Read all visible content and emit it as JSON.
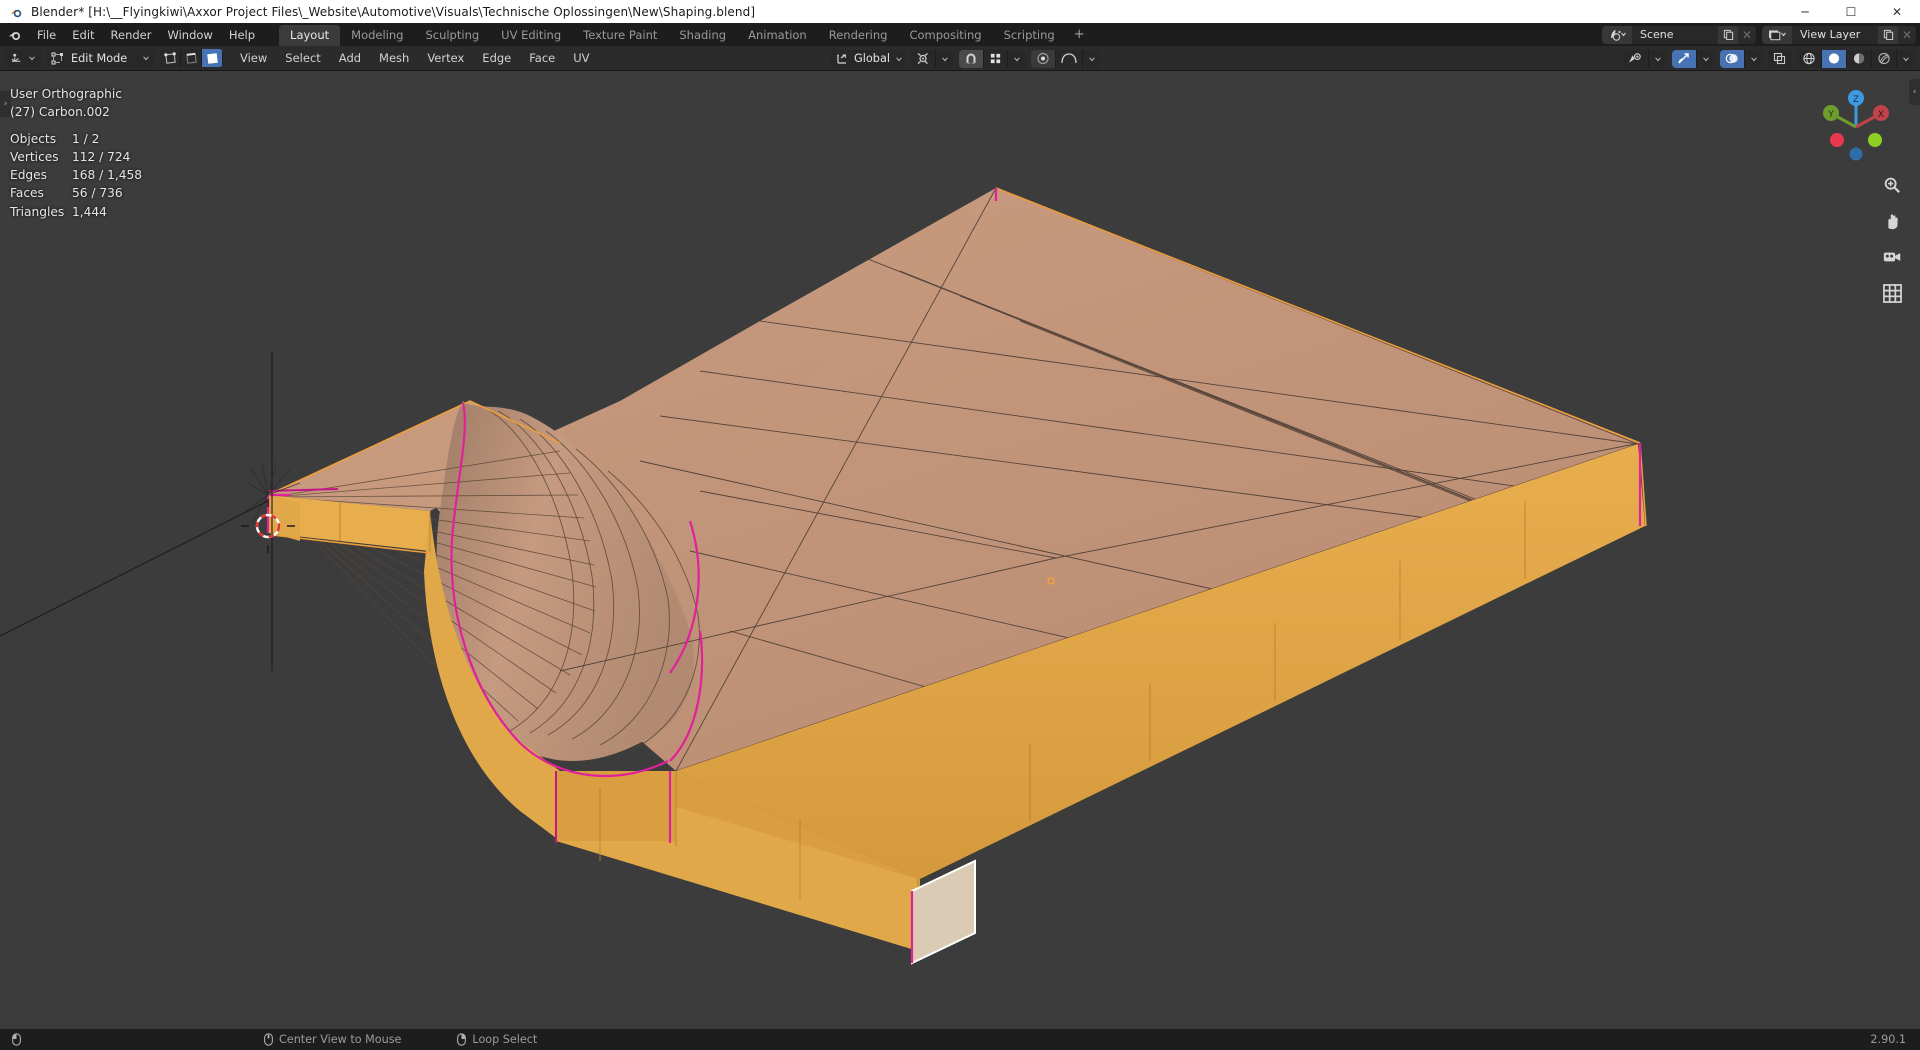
{
  "window": {
    "title": "Blender* [H:\\__Flyingkiwi\\Axxor Project Files\\_Website\\Automotive\\Visuals\\Technische Oplossingen\\New\\Shaping.blend]",
    "app_icon": "blender-logo-icon",
    "minimize": "─",
    "maximize": "☐",
    "close": "✕"
  },
  "topbar": {
    "menus": [
      "File",
      "Edit",
      "Render",
      "Window",
      "Help"
    ],
    "workspaces": [
      {
        "label": "Layout",
        "active": true
      },
      {
        "label": "Modeling",
        "active": false
      },
      {
        "label": "Sculpting",
        "active": false
      },
      {
        "label": "UV Editing",
        "active": false
      },
      {
        "label": "Texture Paint",
        "active": false
      },
      {
        "label": "Shading",
        "active": false
      },
      {
        "label": "Animation",
        "active": false
      },
      {
        "label": "Rendering",
        "active": false
      },
      {
        "label": "Compositing",
        "active": false
      },
      {
        "label": "Scripting",
        "active": false
      }
    ],
    "add_workspace": "+",
    "scene_name": "Scene",
    "view_layer_name": "View Layer"
  },
  "toolheader": {
    "mode": "Edit Mode",
    "select_modes": [
      "vertex-select",
      "edge-select",
      "face-select"
    ],
    "active_select_mode": "face-select",
    "menus": [
      "View",
      "Select",
      "Add",
      "Mesh",
      "Vertex",
      "Edge",
      "Face",
      "UV"
    ],
    "transform_orientation": "Global",
    "snap_enabled": true,
    "proportional_editing": false
  },
  "viewport": {
    "view_name": "User Orthographic",
    "object_name": "(27) Carbon.002",
    "stats": [
      {
        "label": "Objects",
        "value": "1 / 2"
      },
      {
        "label": "Vertices",
        "value": "112 / 724"
      },
      {
        "label": "Edges",
        "value": "168 / 1,458"
      },
      {
        "label": "Faces",
        "value": "56 / 736"
      },
      {
        "label": "Triangles",
        "value": "1,444"
      }
    ],
    "shading_mode": "solid",
    "gizmo_axes": [
      "Z",
      "Y",
      "X"
    ],
    "nav_icons": [
      "zoom-icon",
      "pan-icon",
      "camera-icon",
      "ortho-grid-icon"
    ],
    "sidebar_toggle": "›",
    "rightpanel_toggle": "‹",
    "colors": {
      "background": "#3c3c3c",
      "top_face": "#c79a7e",
      "side_face": "#e0a848",
      "side_face_dark": "#c8913a",
      "wire": "#4a3b33",
      "selected_edge": "#e0219b",
      "object_outline": "#ed9e3c",
      "active_face": "#dbcab4",
      "active_face_outline": "#ffffff"
    }
  },
  "statusbar": {
    "items": [
      {
        "icon": "mouse-left-icon",
        "label": ""
      },
      {
        "icon": "mouse-middle-icon",
        "label": "Center View to Mouse"
      },
      {
        "icon": "mouse-right-icon",
        "label": "Loop Select"
      }
    ],
    "version": "2.90.1"
  }
}
